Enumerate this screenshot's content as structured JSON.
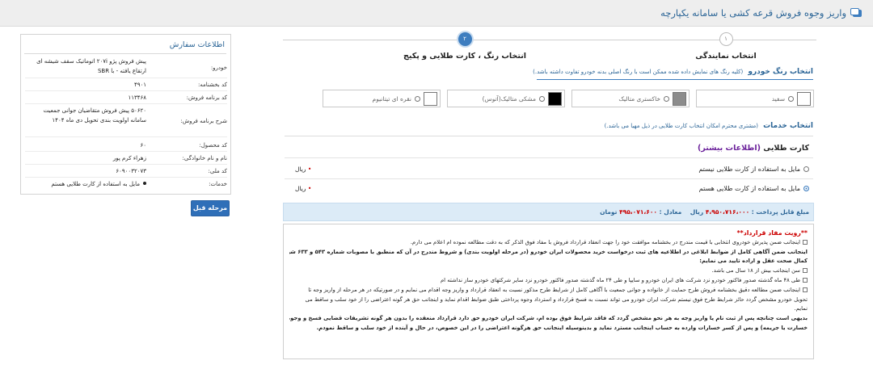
{
  "header": {
    "title": "واریز وجوه فروش قرعه کشی یا سامانه یکپارچه"
  },
  "steps": [
    {
      "number": "۱",
      "label": "انتخاب نمایندگی"
    },
    {
      "number": "۲",
      "label": "انتخاب رنگ ، کارت طلایی و پکیج"
    }
  ],
  "color_section": {
    "title": "انتخاب رنگ خودرو",
    "note": "(کلیه رنگ های نمایش داده شده ممکن است با رنگ اصلی بدنه خودرو تفاوت داشته باشد.)",
    "options": [
      {
        "label": "سفید",
        "swatch": "#ffffff",
        "selected": false
      },
      {
        "label": "خاکستری متالیک",
        "swatch": "#8c8c8c",
        "selected": false
      },
      {
        "label": "مشکی متالیک(آتوس)",
        "swatch": "#000000",
        "selected": false
      },
      {
        "label": "نقره ای تیتانیوم",
        "swatch": "#ffffff",
        "selected": false
      }
    ]
  },
  "services_section": {
    "title": "انتخاب خدمات",
    "note": "(مشتری محترم امکان انتخاب کارت طلایی در ذیل مهیا می باشد.)"
  },
  "golden_card": {
    "title": "کارت طلایی",
    "more_link": "(اطلاعات بیشتر)",
    "options": [
      {
        "label": "مایل به استفاده از کارت طلایی نیستم",
        "price_label": "ریال",
        "selected": false
      },
      {
        "label": "مایل به استفاده از کارت طلایی هستم",
        "price_label": "ریال",
        "selected": true
      }
    ]
  },
  "payable": {
    "label": "مبلغ قابل پرداخت :",
    "amount_rial": "۴،۹۵۰،۷۱۶،۰۰۰",
    "unit_rial": "ریال",
    "equiv_label": "معادل :",
    "amount_toman": "۴۹۵،۰۷۱،۶۰۰",
    "unit_toman": "تومان"
  },
  "contract": {
    "title": "**رویت مفاد قرارداد**",
    "items": [
      {
        "type": "check",
        "text": "اینجانب ضمن پذیرش خودروی انتخابی با قیمت مندرج در بخشنامه موافقت خود را جهت انعقاد قرارداد فروش با مفاد فوق الذکر که به دقت مطالعه نموده ام اعلام می دارم."
      },
      {
        "type": "bold",
        "text": "اینجانب ضمن آگاهی کامل از ضوابط ابلاغی در اطلاعیه های ثبت درخواست خرید محصولات ایران خودرو (در مرحله اولویت بندی) و شروط مندرج در آن که منطبق با مصوبات شماره ۵۴۳ و ۶۳۳ شورای رقابت می باشد، در"
      },
      {
        "type": "bold",
        "text": "کمال صحت عقل و اراده تایید می نمایم:"
      },
      {
        "type": "check",
        "text": "سن اینجانب بیش از ۱۸ سال می باشد."
      },
      {
        "type": "check",
        "text": "طی ۴۸ ماه گذشته صدور فاکتور خودرو نزد شرکت های ایران خودرو و سایپا و طی ۲۴ ماه گذشته صدور فاکتور خودرو نزد سایر شرکتهای خودرو ساز نداشته ام"
      },
      {
        "type": "check",
        "text": "اینجانب ضمن مطالعه دقیق بخشنامه فروش طرح حمایت از خانواده و جوانی جمعیت با آگاهی کامل از شرایط طرح مذکور نسبت به انعقاد قرارداد و واریز وجه اقدام می نمایم و در صورتیکه در هر مرحله از واریز وجه تا"
      },
      {
        "type": "plain",
        "text": "تحویل خودرو مشخص گردد حائز شرایط طرح فوق نیستم شرکت ایران خودرو می تواند نسبت به فسخ قرارداد و استرداد وجوه پرداختی طبق ضوابط اقدام نماید و اینجانب حق هر گونه اعتراضی را از خود سلب و ساقط می"
      },
      {
        "type": "plain",
        "text": "نمایم."
      },
      {
        "type": "bold",
        "text": "بدیهی است چنانچه پس از ثبت نام یا واریز وجه به هر نحو مشخص گردد که فاقد شرایط فوق بوده ام، شرکت ایران خودرو حق دارد قرارداد منعقده را بدون هر گونه تشریفات قضایی فسخ و وجوه مربوطه را (بدون تعلق"
      },
      {
        "type": "bold",
        "text": "خسارت یا جریمه) و پس از کسر خسارات وارده به حساب اینجانب مسترد نماید و بدینوسیله اینجانب حق هرگونه اعتراضی را در این خصوص، در حال و آینده از خود سلب و ساقط نمودم."
      }
    ]
  },
  "order_info": {
    "title": "اطلاعات سفارش",
    "rows": [
      {
        "key": "خودرو:",
        "value": "پیش فروش پژو ۲۰۷i اتوماتیک سقف شیشه ای ارتقاع یافته - با SBR",
        "bullet": false
      },
      {
        "key": "کد بخشنامه:",
        "value": "۴۹۰۱",
        "bullet": false
      },
      {
        "key": "کد برنامه فروش:",
        "value": "۱۱۳۴۶۸",
        "bullet": false
      },
      {
        "key": "شرح برنامه فروش:",
        "value": "۵۰۶۲۰ پیش فروش متقاضیان جوانی جمعیت سامانه اولویت بندی تحویل دی ماه ۱۴۰۴",
        "bullet": false
      },
      {
        "key": "کد محصول:",
        "value": "۶۰",
        "bullet": false
      },
      {
        "key": "نام و نام خانوادگی:",
        "value": "زهراء کرم پور",
        "bullet": false
      },
      {
        "key": "کد ملی:",
        "value": "۶۰۹۰۰۳۲۰۷۳",
        "bullet": false
      },
      {
        "key": "خدمات:",
        "value": "مایل به استفاده از کارت طلایی هستم",
        "bullet": true
      }
    ]
  },
  "actions": {
    "prev_label": "مرحله قبل"
  },
  "colors": {
    "accent": "#3d7dbf",
    "link": "#2a6496",
    "alert": "#cc0000",
    "payable_bg": "#dcebf7"
  }
}
